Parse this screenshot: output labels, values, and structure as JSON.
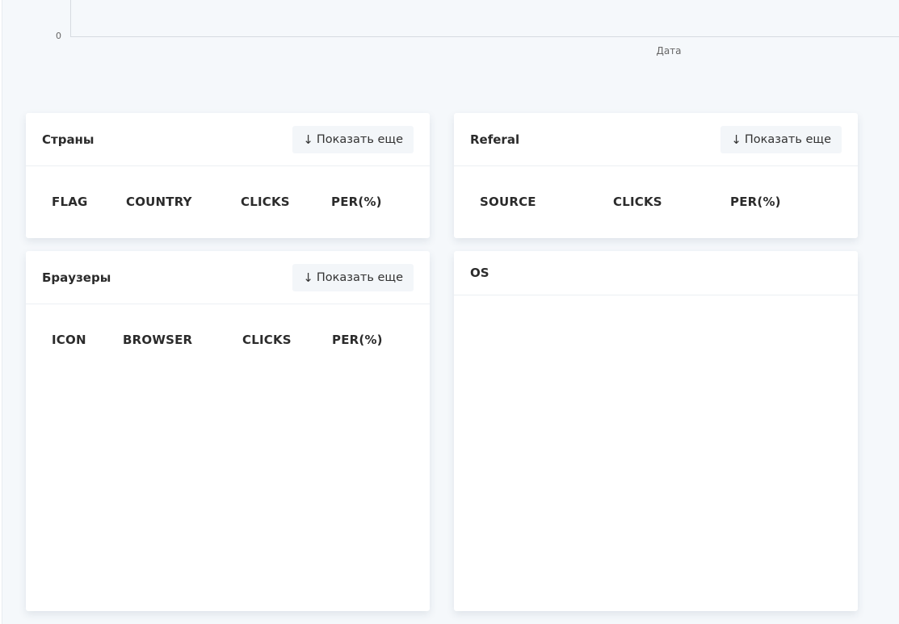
{
  "chart": {
    "y_tick": "0",
    "x_axis_label": "Дата"
  },
  "chart_data": {
    "type": "line",
    "xlabel": "Дата",
    "ylabel": "",
    "y_ticks": [
      "0"
    ],
    "series": []
  },
  "panels": {
    "countries": {
      "title": "Страны",
      "more_label": "Показать еще",
      "columns": [
        "FLAG",
        "COUNTRY",
        "CLICKS",
        "PER(%)"
      ]
    },
    "referal": {
      "title": "Referal",
      "more_label": "Показать еще",
      "columns": [
        "SOURCE",
        "CLICKS",
        "PER(%)"
      ]
    },
    "browsers": {
      "title": "Браузеры",
      "more_label": "Показать еще",
      "columns": [
        "ICON",
        "BROWSER",
        "CLICKS",
        "PER(%)"
      ]
    },
    "os": {
      "title": "OS"
    }
  },
  "icons": {
    "more_arrow": "arrow-down-icon",
    "more_arrow_glyph": "↓"
  },
  "colors": {
    "page_background": "#f5f8fb",
    "card_background": "#ffffff",
    "button_background": "#f3f6f9",
    "text": "#2b2b2b"
  }
}
